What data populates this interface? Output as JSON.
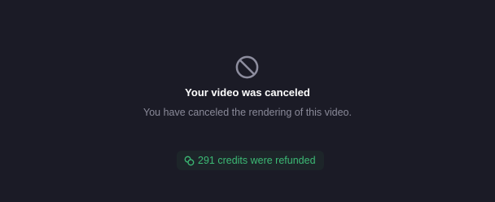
{
  "status": {
    "icon": "cancel-icon",
    "title": "Your video was canceled",
    "message": "You have canceled the rendering of this video."
  },
  "refund": {
    "icon": "coins-icon",
    "text": "291 credits were refunded",
    "color": "#3cba75"
  },
  "colors": {
    "background": "#1b1b26",
    "icon": "#8d8d9e",
    "title": "#ffffff",
    "message": "#8a8a99",
    "badge_background": "#1d2529"
  }
}
